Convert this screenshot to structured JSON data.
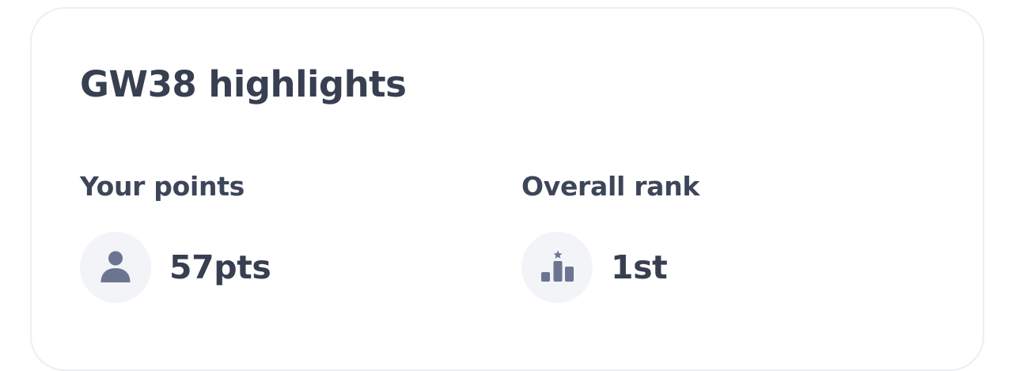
{
  "highlights": {
    "title": "GW38 highlights",
    "points": {
      "label": "Your points",
      "value": "57pts",
      "icon": "person-icon"
    },
    "rank": {
      "label": "Overall rank",
      "value": "1st",
      "icon": "podium-icon"
    },
    "colors": {
      "text": "#373f51",
      "icon": "#6b7591",
      "icon_background": "#f3f4f7",
      "card_border": "#eceef2"
    }
  }
}
